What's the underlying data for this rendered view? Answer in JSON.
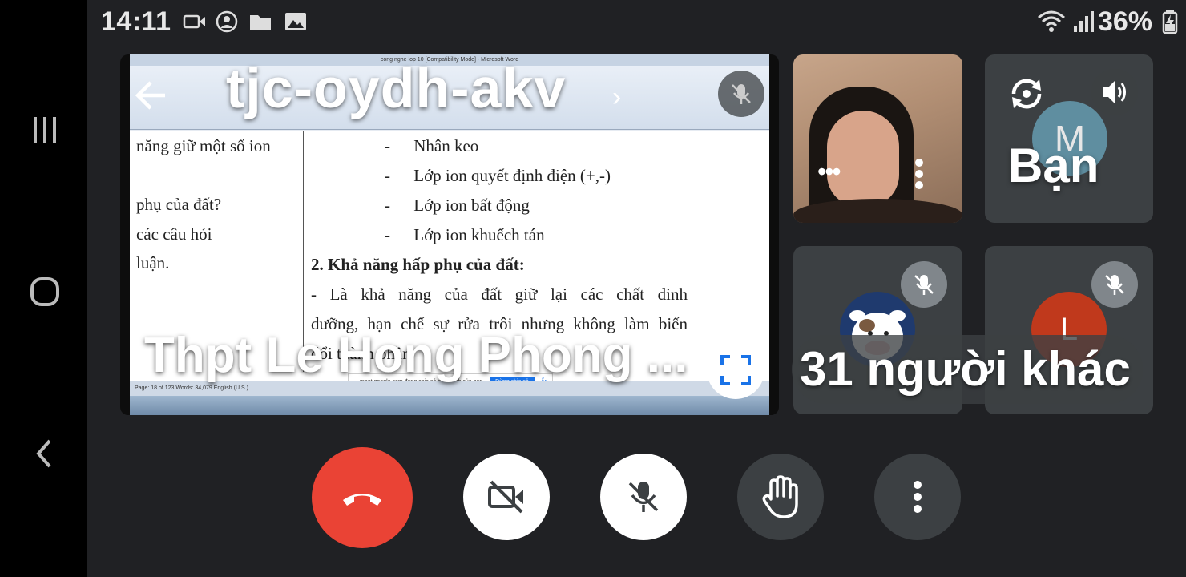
{
  "status_bar": {
    "time": "14:11",
    "battery": "36%"
  },
  "meeting": {
    "code": "tjc-oydh-akv",
    "presenter_name": "Thpt Le Hong Phong ...",
    "others_count_label": "31 người khác",
    "self_label": "Bạn",
    "self_initial": "M",
    "participant_initial": "L"
  },
  "document": {
    "window_title": "cong nghe lop 10 [Compatibility Mode] - Microsoft Word",
    "left_column": [
      "năng giữ một số ion",
      "",
      "phụ của đất?",
      "các câu hỏi",
      "luận."
    ],
    "bullets": [
      "Nhân keo",
      "Lớp ion quyết định điện (+,-)",
      "Lớp ion bất động",
      "Lớp ion khuếch tán"
    ],
    "heading": "2. Khả năng hấp phụ của đất:",
    "paragraph_line1": "- Là khả năng của đất giữ lại các chất dinh",
    "paragraph_line2": "dưỡng, hạn chế sự rửa trôi nhưng không làm biến",
    "paragraph_line3": "đổi thành phần",
    "status_text": "Page: 18 of 123    Words: 34,079    English (U.S.)",
    "share_text": "meet.google.com đang chia sẻ màn hình của bạn.",
    "share_stop": "Dừng chia sẻ",
    "share_hide": "Ẩn"
  },
  "colors": {
    "end_call": "#ea4335",
    "tile_bg": "#3c4043",
    "main_bg": "#202124",
    "accent_blue": "#1a73e8"
  }
}
